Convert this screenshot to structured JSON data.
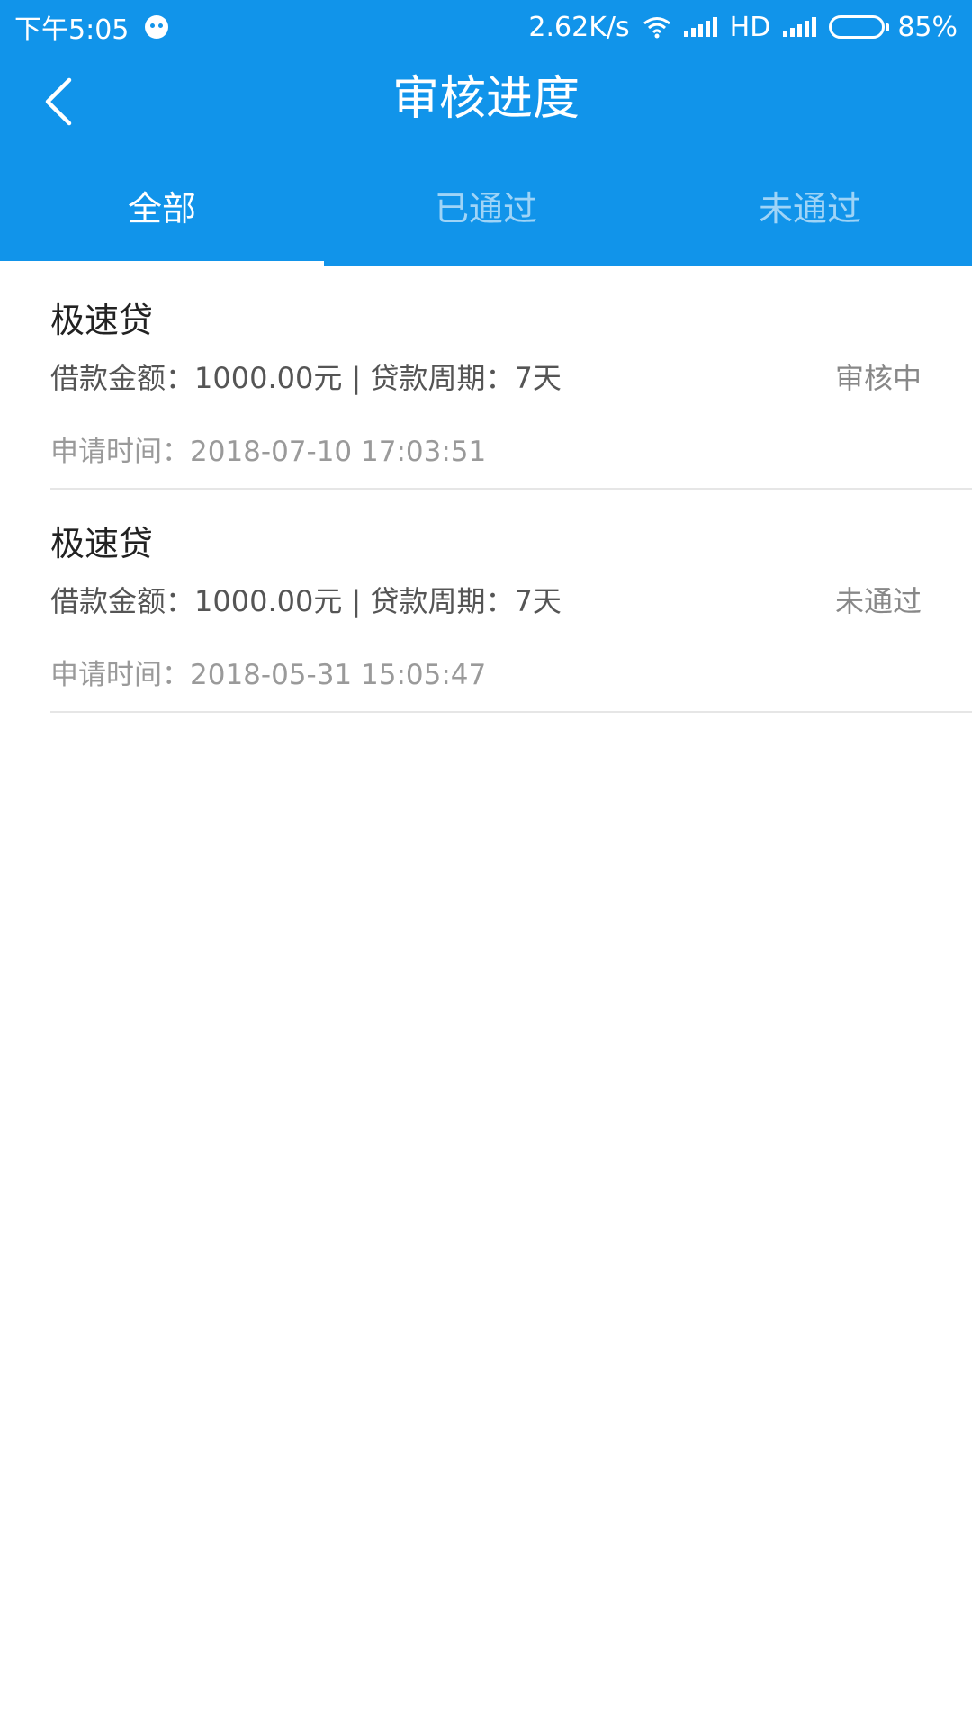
{
  "status_bar": {
    "time": "下午5:05",
    "net_speed": "2.62K/s",
    "network_type": "HD",
    "battery_percent": "85%",
    "battery_level": 0.85
  },
  "nav": {
    "title": "审核进度",
    "back_icon": "chevron-left-icon"
  },
  "tabs": [
    {
      "label": "全部",
      "active": true
    },
    {
      "label": "已通过",
      "active": false
    },
    {
      "label": "未通过",
      "active": false
    }
  ],
  "applications": [
    {
      "title": "极速贷",
      "detail": "借款金额：1000.00元 | 贷款周期：7天",
      "status": "审核中",
      "time": "申请时间：2018-07-10 17:03:51"
    },
    {
      "title": "极速贷",
      "detail": "借款金额：1000.00元 | 贷款周期：7天",
      "status": "未通过",
      "time": "申请时间：2018-05-31 15:05:47"
    }
  ],
  "colors": {
    "primary": "#1194ea",
    "title_text": "#222222",
    "detail_text": "#555555",
    "status_text": "#888888",
    "time_text": "#9a9a9a",
    "divider": "#e6e6e6"
  }
}
